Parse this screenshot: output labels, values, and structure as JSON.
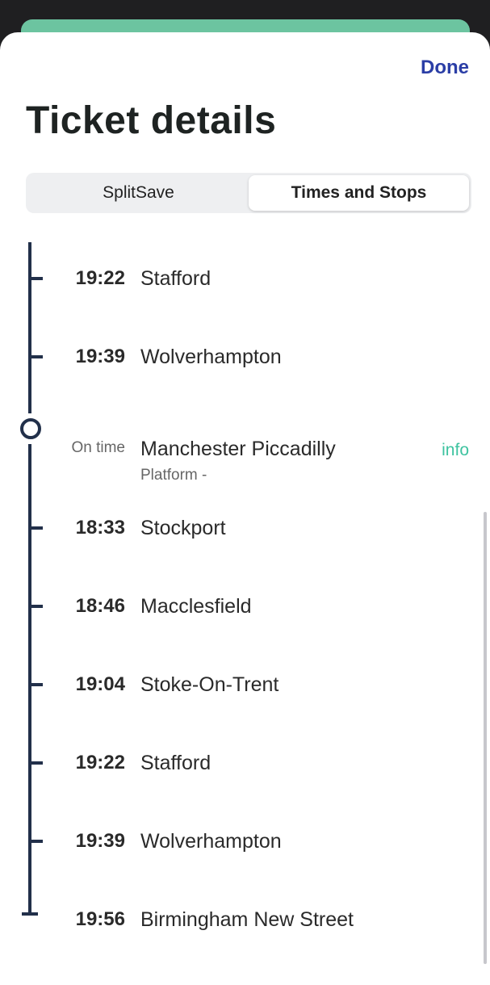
{
  "header": {
    "done_label": "Done",
    "title": "Ticket details"
  },
  "tabs": [
    {
      "label": "SplitSave",
      "active": false
    },
    {
      "label": "Times and Stops",
      "active": true
    }
  ],
  "stops_upper": [
    {
      "time": "19:22",
      "name": "Stafford"
    },
    {
      "time": "19:39",
      "name": "Wolverhampton"
    }
  ],
  "current_stop": {
    "status": "On time",
    "name": "Manchester Piccadilly",
    "platform": "Platform -",
    "info_label": "info"
  },
  "stops_lower": [
    {
      "time": "18:33",
      "name": "Stockport"
    },
    {
      "time": "18:46",
      "name": "Macclesfield"
    },
    {
      "time": "19:04",
      "name": "Stoke-On-Trent"
    },
    {
      "time": "19:22",
      "name": "Stafford"
    },
    {
      "time": "19:39",
      "name": "Wolverhampton"
    },
    {
      "time": "19:56",
      "name": "Birmingham New Street"
    }
  ],
  "colors": {
    "accent_blue": "#2b3ea6",
    "accent_green": "#3ec3a0",
    "timeline": "#22304a"
  }
}
